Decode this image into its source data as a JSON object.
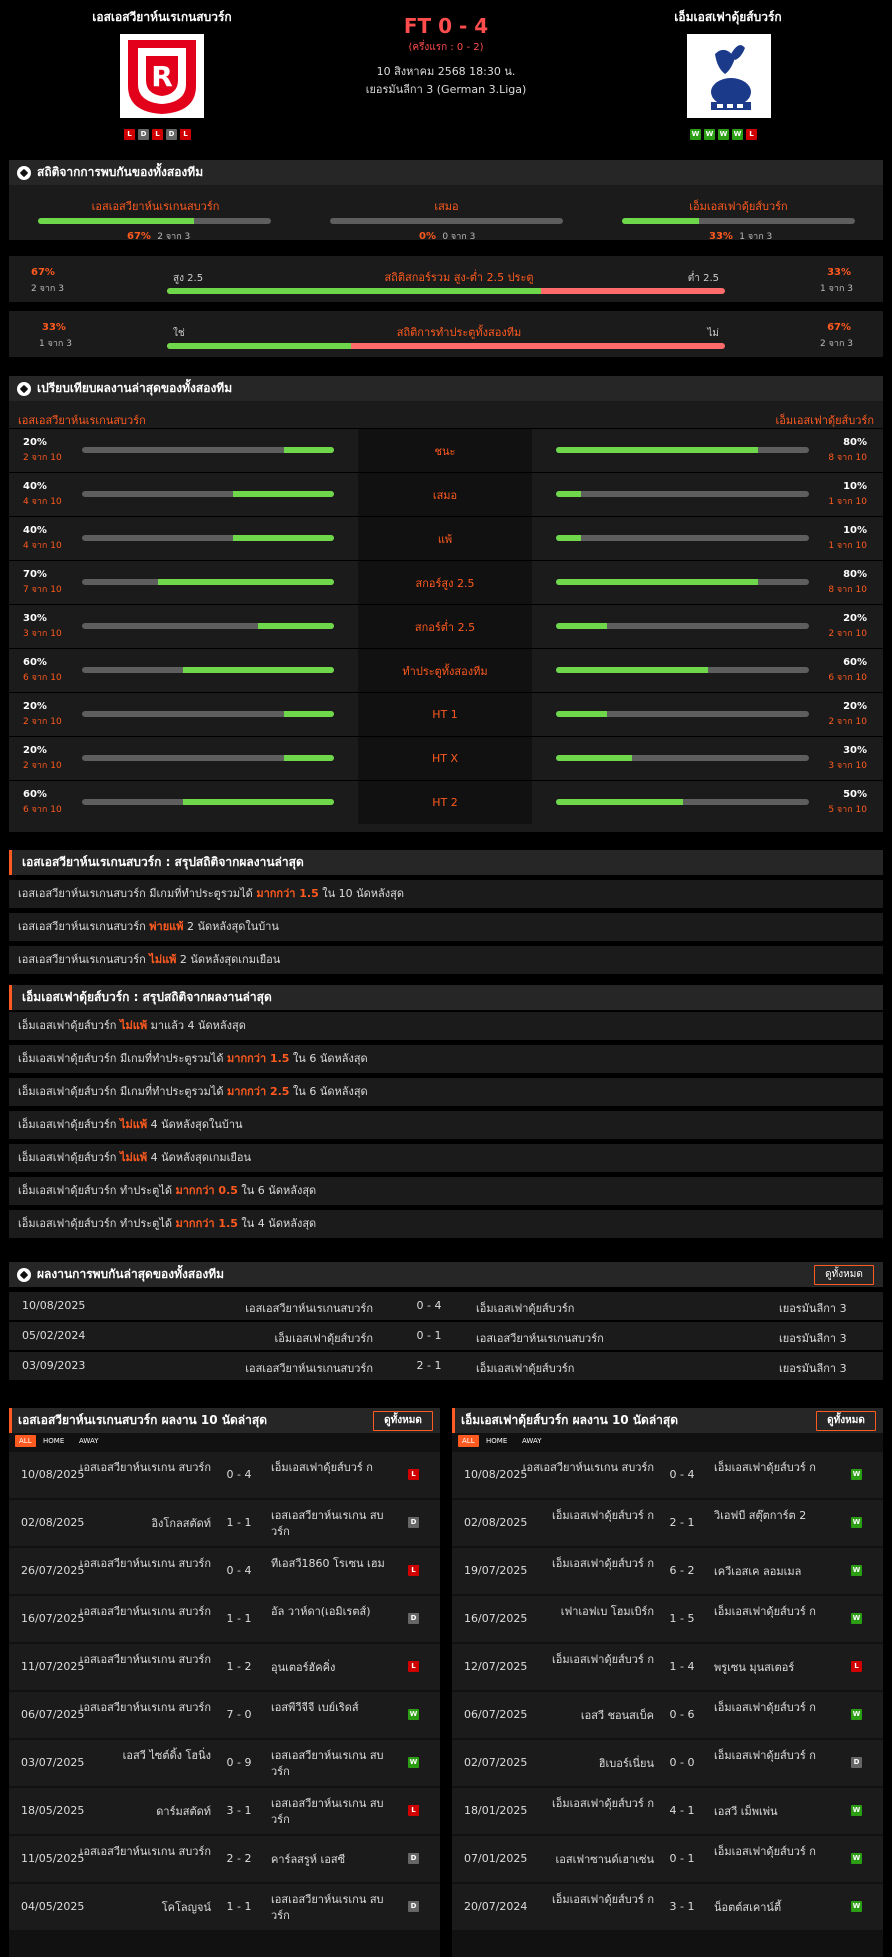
{
  "header": {
    "home_team": "เอสเอสวียาห์นเรเกนสบวร์ก",
    "away_team": "เอ็มเอสเฟาดุ้ยส์บวร์ก",
    "score": "FT 0 - 4",
    "halftime": "(ครึ่งแรก : 0 - 2)",
    "date": "10 สิงหาคม 2568 18:30 น.",
    "league": "เยอรมันลีกา 3 (German 3.Liga)",
    "home_form": [
      "L",
      "D",
      "L",
      "D",
      "L"
    ],
    "away_form": [
      "W",
      "W",
      "W",
      "W",
      "L"
    ]
  },
  "h2h_stats": {
    "title": "สถิติจากการพบกันของทั้งสองทีม",
    "home": {
      "label": "เอสเอสวียาห์นเรเกนสบวร์ก",
      "pct": "67%",
      "sub": "2 จาก 3",
      "fill": 0.67
    },
    "draw": {
      "label": "เสมอ",
      "pct": "0%",
      "sub": "0 จาก 3",
      "fill": 0
    },
    "away": {
      "label": "เอ็มเอสเฟาดุ้ยส์บวร์ก",
      "pct": "33%",
      "sub": "1 จาก 3",
      "fill": 0.33
    },
    "ou": {
      "title": "สถิติสกอร์รวม สูง-ต่ำ 2.5 ประตู",
      "left_pct": "67%",
      "left_sub": "2 จาก 3",
      "left_label": "สูง 2.5",
      "right_pct": "33%",
      "right_sub": "1 จาก 3",
      "right_label": "ต่ำ 2.5",
      "fill": 0.67
    },
    "btts": {
      "title": "สถิติการทำประตูทั้งสองทีม",
      "left_pct": "33%",
      "left_sub": "1 จาก 3",
      "left_label": "ใช่",
      "right_pct": "67%",
      "right_sub": "2 จาก 3",
      "right_label": "ไม่",
      "fill": 0.33
    }
  },
  "compare": {
    "title": "เปรียบเทียบผลงานล่าสุดของทั้งสองทีม",
    "home_label": "เอสเอสวียาห์นเรเกนสบวร์ก",
    "away_label": "เอ็มเอสเฟาดุ้ยส์บวร์ก",
    "rows": [
      {
        "label": "ชนะ",
        "lp": "20%",
        "ls": "2 จาก 10",
        "lf": 0.2,
        "rp": "80%",
        "rs": "8 จาก 10",
        "rf": 0.8
      },
      {
        "label": "เสมอ",
        "lp": "40%",
        "ls": "4 จาก 10",
        "lf": 0.4,
        "rp": "10%",
        "rs": "1 จาก 10",
        "rf": 0.1
      },
      {
        "label": "แพ้",
        "lp": "40%",
        "ls": "4 จาก 10",
        "lf": 0.4,
        "rp": "10%",
        "rs": "1 จาก 10",
        "rf": 0.1
      },
      {
        "label": "สกอร์สูง 2.5",
        "lp": "70%",
        "ls": "7 จาก 10",
        "lf": 0.7,
        "rp": "80%",
        "rs": "8 จาก 10",
        "rf": 0.8
      },
      {
        "label": "สกอร์ต่ำ 2.5",
        "lp": "30%",
        "ls": "3 จาก 10",
        "lf": 0.3,
        "rp": "20%",
        "rs": "2 จาก 10",
        "rf": 0.2
      },
      {
        "label": "ทำประตูทั้งสองทีม",
        "lp": "60%",
        "ls": "6 จาก 10",
        "lf": 0.6,
        "rp": "60%",
        "rs": "6 จาก 10",
        "rf": 0.6
      },
      {
        "label": "HT 1",
        "lp": "20%",
        "ls": "2 จาก 10",
        "lf": 0.2,
        "rp": "20%",
        "rs": "2 จาก 10",
        "rf": 0.2
      },
      {
        "label": "HT X",
        "lp": "20%",
        "ls": "2 จาก 10",
        "lf": 0.2,
        "rp": "30%",
        "rs": "3 จาก 10",
        "rf": 0.3
      },
      {
        "label": "HT 2",
        "lp": "60%",
        "ls": "6 จาก 10",
        "lf": 0.6,
        "rp": "50%",
        "rs": "5 จาก 10",
        "rf": 0.5
      }
    ]
  },
  "home_summary": {
    "title": "เอสเอสวียาห์นเรเกนสบวร์ก : สรุปสถิติจากผลงานล่าสุด",
    "rows": [
      {
        "pre": "เอสเอสวียาห์นเรเกนสบวร์ก มีเกมที่ทำประตูรวมได้",
        "hl": "มากกว่า 1.5",
        "post": "ใน 10 นัดหลังสุด"
      },
      {
        "pre": "เอสเอสวียาห์นเรเกนสบวร์ก",
        "hl": "พ่ายแพ้",
        "post": "2 นัดหลังสุดในบ้าน"
      },
      {
        "pre": "เอสเอสวียาห์นเรเกนสบวร์ก",
        "hl": "ไม่แพ้",
        "post": "2 นัดหลังสุดเกมเยือน"
      }
    ]
  },
  "away_summary": {
    "title": "เอ็มเอสเฟาดุ้ยส์บวร์ก : สรุปสถิติจากผลงานล่าสุด",
    "rows": [
      {
        "pre": "เอ็มเอสเฟาดุ้ยส์บวร์ก",
        "hl": "ไม่แพ้",
        "post": "มาแล้ว 4 นัดหลังสุด"
      },
      {
        "pre": "เอ็มเอสเฟาดุ้ยส์บวร์ก มีเกมที่ทำประตูรวมได้",
        "hl": "มากกว่า 1.5",
        "post": "ใน 6 นัดหลังสุด"
      },
      {
        "pre": "เอ็มเอสเฟาดุ้ยส์บวร์ก มีเกมที่ทำประตูรวมได้",
        "hl": "มากกว่า 2.5",
        "post": "ใน 6 นัดหลังสุด"
      },
      {
        "pre": "เอ็มเอสเฟาดุ้ยส์บวร์ก",
        "hl": "ไม่แพ้",
        "post": "4 นัดหลังสุดในบ้าน"
      },
      {
        "pre": "เอ็มเอสเฟาดุ้ยส์บวร์ก",
        "hl": "ไม่แพ้",
        "post": "4 นัดหลังสุดเกมเยือน"
      },
      {
        "pre": "เอ็มเอสเฟาดุ้ยส์บวร์ก ทำประตูได้",
        "hl": "มากกว่า 0.5",
        "post": "ใน 6 นัดหลังสุด"
      },
      {
        "pre": "เอ็มเอสเฟาดุ้ยส์บวร์ก ทำประตูได้",
        "hl": "มากกว่า 1.5",
        "post": "ใน 4 นัดหลังสุด"
      }
    ]
  },
  "h2h_results": {
    "title": "ผลงานการพบกันล่าสุดของทั้งสองทีม",
    "view_all": "ดูทั้งหมด",
    "rows": [
      {
        "date": "10/08/2025",
        "home": "เอสเอสวียาห์นเรเกนสบวร์ก",
        "score": "0 - 4",
        "away": "เอ็มเอสเฟาดุ้ยส์บวร์ก",
        "league": "เยอรมันลีกา 3"
      },
      {
        "date": "05/02/2024",
        "home": "เอ็มเอสเฟาดุ้ยส์บวร์ก",
        "score": "0 - 1",
        "away": "เอสเอสวียาห์นเรเกนสบวร์ก",
        "league": "เยอรมันลีกา 3"
      },
      {
        "date": "03/09/2023",
        "home": "เอสเอสวียาห์นเรเกนสบวร์ก",
        "score": "2 - 1",
        "away": "เอ็มเอสเฟาดุ้ยส์บวร์ก",
        "league": "เยอรมันลีกา 3"
      }
    ]
  },
  "home_last10": {
    "title": "เอสเอสวียาห์นเรเกนสบวร์ก ผลงาน 10 นัดล่าสุด",
    "view_all": "ดูทั้งหมด",
    "tabs": [
      "ALL",
      "HOME",
      "AWAY"
    ],
    "rows": [
      {
        "date": "10/08/2025",
        "home": "เอสเอสวียาห์นเรเกน สบวร์ก",
        "score": "0 - 4",
        "away": "เอ็มเอสเฟาดุ้ยส์บวร์ ก",
        "res": "L"
      },
      {
        "date": "02/08/2025",
        "home": "อิงโกลสตัดท์",
        "score": "1 - 1",
        "away": "เอสเอสวียาห์นเรเกน สบวร์ก",
        "res": "D"
      },
      {
        "date": "26/07/2025",
        "home": "เอสเอสวียาห์นเรเกน สบวร์ก",
        "score": "0 - 4",
        "away": "ทีเอสวี1860 โรเซน เฮม",
        "res": "L"
      },
      {
        "date": "16/07/2025",
        "home": "เอสเอสวียาห์นเรเกน สบวร์ก",
        "score": "1 - 1",
        "away": "อัล วาห์ดา(เอมิเรตส์)",
        "res": "D"
      },
      {
        "date": "11/07/2025",
        "home": "เอสเอสวียาห์นเรเกน สบวร์ก",
        "score": "1 - 2",
        "away": "อุนเตอร์ฮัคคิ่ง",
        "res": "L"
      },
      {
        "date": "06/07/2025",
        "home": "เอสเอสวียาห์นเรเกน สบวร์ก",
        "score": "7 - 0",
        "away": "เอสพีวีจีจี เบย์เริดส์",
        "res": "W"
      },
      {
        "date": "03/07/2025",
        "home": "เอสวี ไซต์ดิ้ง โฮนิ่ง",
        "score": "0 - 9",
        "away": "เอสเอสวียาห์นเรเกน สบวร์ก",
        "res": "W"
      },
      {
        "date": "18/05/2025",
        "home": "ดาร์มสตัดท์",
        "score": "3 - 1",
        "away": "เอสเอสวียาห์นเรเกน สบวร์ก",
        "res": "L"
      },
      {
        "date": "11/05/2025",
        "home": "เอสเอสวียาห์นเรเกน สบวร์ก",
        "score": "2 - 2",
        "away": "คาร์ลสรูห์ เอสซี",
        "res": "D"
      },
      {
        "date": "04/05/2025",
        "home": "โคโลญจน์",
        "score": "1 - 1",
        "away": "เอสเอสวียาห์นเรเกน สบวร์ก",
        "res": "D"
      }
    ]
  },
  "away_last10": {
    "title": "เอ็มเอสเฟาดุ้ยส์บวร์ก ผลงาน 10 นัดล่าสุด",
    "view_all": "ดูทั้งหมด",
    "tabs": [
      "ALL",
      "HOME",
      "AWAY"
    ],
    "rows": [
      {
        "date": "10/08/2025",
        "home": "เอสเอสวียาห์นเรเกน สบวร์ก",
        "score": "0 - 4",
        "away": "เอ็มเอสเฟาดุ้ยส์บวร์ ก",
        "res": "W"
      },
      {
        "date": "02/08/2025",
        "home": "เอ็มเอสเฟาดุ้ยส์บวร์ ก",
        "score": "2 - 1",
        "away": "วิเอฟบี สตุ๊ตการ์ต 2",
        "res": "W"
      },
      {
        "date": "19/07/2025",
        "home": "เอ็มเอสเฟาดุ้ยส์บวร์ ก",
        "score": "6 - 2",
        "away": "เควีเอสเค ลอมเมล",
        "res": "W"
      },
      {
        "date": "16/07/2025",
        "home": "เฟาเอฟเบ โฮมเบิร์ก",
        "score": "1 - 5",
        "away": "เอ็มเอสเฟาดุ้ยส์บวร์ ก",
        "res": "W"
      },
      {
        "date": "12/07/2025",
        "home": "เอ็มเอสเฟาดุ้ยส์บวร์ ก",
        "score": "1 - 4",
        "away": "พรูเซน มุนสเตอร์",
        "res": "L"
      },
      {
        "date": "06/07/2025",
        "home": "เอสวี ชอนสเบ็ค",
        "score": "0 - 6",
        "away": "เอ็มเอสเฟาดุ้ยส์บวร์ ก",
        "res": "W"
      },
      {
        "date": "02/07/2025",
        "home": "ฮิเบอร์เนี่ยน",
        "score": "0 - 0",
        "away": "เอ็มเอสเฟาดุ้ยส์บวร์ ก",
        "res": "D"
      },
      {
        "date": "18/01/2025",
        "home": "เอ็มเอสเฟาดุ้ยส์บวร์ ก",
        "score": "4 - 1",
        "away": "เอสวี เม็พเพ่น",
        "res": "W"
      },
      {
        "date": "07/01/2025",
        "home": "เอสเฟาซานด์เฮาเซ่น",
        "score": "0 - 1",
        "away": "เอ็มเอสเฟาดุ้ยส์บวร์ ก",
        "res": "W"
      },
      {
        "date": "20/07/2024",
        "home": "เอ็มเอสเฟาดุ้ยส์บวร์ ก",
        "score": "3 - 1",
        "away": "น็อตต์สเคาน์ตี้",
        "res": "W"
      }
    ]
  },
  "colors": {
    "accent": "#ff5a1f",
    "green": "#6fd84a",
    "red": "#ff6b6b",
    "win": "#2c9e14",
    "loss": "#d10000",
    "draw": "#666666"
  }
}
